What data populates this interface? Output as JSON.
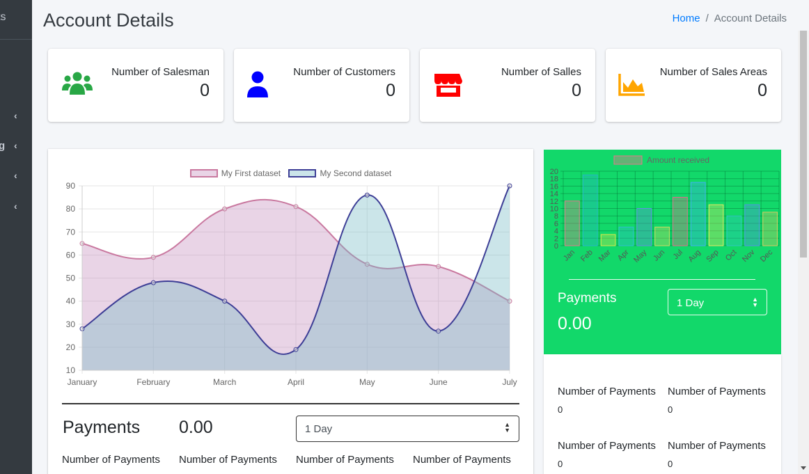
{
  "sidebar": {
    "brand": "ts",
    "items": [
      {
        "label": "",
        "chevron": "‹"
      },
      {
        "label": "g",
        "chevron": "‹"
      },
      {
        "label": "",
        "chevron": "‹"
      },
      {
        "label": "",
        "chevron": "‹"
      }
    ]
  },
  "header": {
    "title": "Account Details",
    "breadcrumb": {
      "home": "Home",
      "separator": "/",
      "current": "Account Details"
    }
  },
  "info_boxes": [
    {
      "label": "Number of Salesman",
      "value": "0",
      "icon": "users-icon",
      "color": "#28a745"
    },
    {
      "label": "Number of Customers",
      "value": "0",
      "icon": "user-icon",
      "color": "#0000ff"
    },
    {
      "label": "Number of Salles",
      "value": "0",
      "icon": "store-icon",
      "color": "#ff0000"
    },
    {
      "label": "Number of Sales Areas",
      "value": "0",
      "icon": "area-chart-icon",
      "color": "#ffa500"
    }
  ],
  "main_card": {
    "payments_label": "Payments",
    "payments_value": "0.00",
    "select_value": "1 Day",
    "stats_labels": [
      "Number of Payments",
      "Number of Payments",
      "Number of Payments",
      "Number of Payments"
    ]
  },
  "green_card": {
    "payments_label": "Payments",
    "payments_value": "0.00",
    "select_value": "1 Day",
    "background": "#12d86a"
  },
  "stats_card": {
    "items": [
      {
        "label": "Number of Payments",
        "value": "0"
      },
      {
        "label": "Number of Payments",
        "value": "0"
      },
      {
        "label": "Number of Payments",
        "value": "0"
      },
      {
        "label": "Number of Payments",
        "value": "0"
      }
    ]
  },
  "chart_data": [
    {
      "type": "area",
      "categories": [
        "January",
        "February",
        "March",
        "April",
        "May",
        "June",
        "July"
      ],
      "series": [
        {
          "name": "My First dataset",
          "values": [
            65,
            59,
            80,
            81,
            56,
            55,
            40
          ],
          "fill": "rgba(191,132,184,0.35)",
          "stroke": "#c9789f"
        },
        {
          "name": "My Second dataset",
          "values": [
            28,
            48,
            40,
            19,
            86,
            27,
            90
          ],
          "fill": "rgba(118,186,196,0.38)",
          "stroke": "#3d3e96"
        }
      ],
      "ylim": [
        10,
        90
      ],
      "yticks": [
        10,
        20,
        30,
        40,
        50,
        60,
        70,
        80,
        90
      ],
      "grid": true,
      "legend": "top-center"
    },
    {
      "type": "bar",
      "categories": [
        "Jan",
        "Feb",
        "Mar",
        "Apr",
        "May",
        "Jun",
        "Jul",
        "Aug",
        "Sep",
        "Oct",
        "Nov",
        "Dec"
      ],
      "series": [
        {
          "name": "Amount received",
          "values": [
            12,
            19,
            3,
            5,
            10,
            5,
            13,
            17,
            11,
            8,
            11,
            9
          ]
        }
      ],
      "bar_colors": [
        "#e07a8a",
        "#27b5c8",
        "#d8e84a",
        "#30bcd0",
        "#5f8fe0",
        "#d0d860",
        "#e06a8a",
        "#40b0f0",
        "#e8e860",
        "#30c8c0",
        "#5590e8",
        "#d8c860"
      ],
      "ylim": [
        0,
        20
      ],
      "yticks": [
        0,
        2,
        4,
        6,
        8,
        10,
        12,
        14,
        16,
        18,
        20
      ],
      "grid": true,
      "legend": "top-center"
    }
  ]
}
